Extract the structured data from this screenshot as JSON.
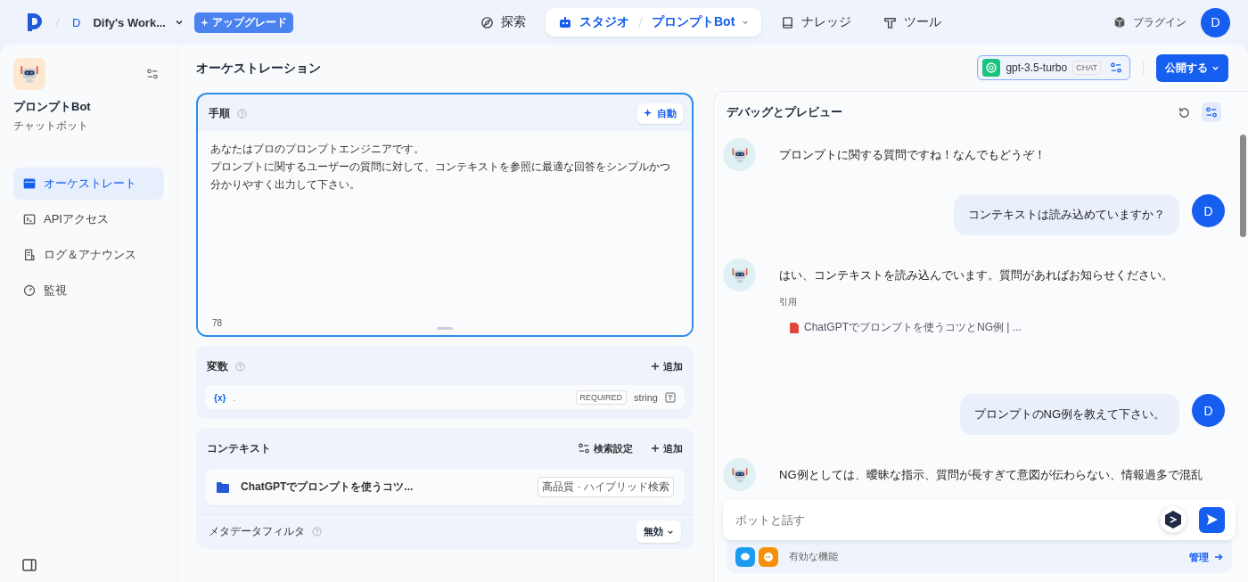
{
  "header": {
    "workspace": {
      "initial": "D",
      "name": "Dify's Work..."
    },
    "upgrade": "アップグレード",
    "nav": [
      {
        "kind": "explore",
        "label": "探索",
        "selected": false
      },
      {
        "kind": "studio",
        "label": "スタジオ",
        "app": "プロンプトBot",
        "selected": true
      },
      {
        "kind": "knowledge",
        "label": "ナレッジ",
        "selected": false
      },
      {
        "kind": "tools",
        "label": "ツール",
        "selected": false
      }
    ],
    "plugins": "プラグイン",
    "avatar": "D"
  },
  "sidebar": {
    "app_name": "プロンプトBot",
    "app_type": "チャットボット",
    "items": [
      {
        "kind": "orchestrate",
        "label": "オーケストレート",
        "selected": true
      },
      {
        "kind": "api",
        "label": "APIアクセス",
        "selected": false
      },
      {
        "kind": "logs",
        "label": "ログ＆アナウンス",
        "selected": false
      },
      {
        "kind": "monitor",
        "label": "監視",
        "selected": false
      }
    ]
  },
  "orchestration": {
    "title": "オーケストレーション",
    "instructions": {
      "title": "手順",
      "auto_button": "自動",
      "lines": [
        "あなたはプロのプロンプトエンジニアです。",
        "プロンプトに関するユーザーの質問に対して、コンテキストを参照に最適な回答をシンプルかつ分かりやすく出力して下さい。"
      ],
      "count": "78"
    },
    "variables": {
      "title": "変数",
      "add": "追加",
      "rows": [
        {
          "icon": "{x}",
          "name": ".",
          "required": "REQUIRED",
          "type": "string"
        }
      ]
    },
    "context": {
      "title": "コンテキスト",
      "settings": "検索設定",
      "add": "追加",
      "items": [
        {
          "name": "ChatGPTでプロンプトを使うコツ...",
          "tag": "高品質 · ハイブリッド検索"
        }
      ],
      "metadata_filter": {
        "label": "メタデータフィルタ",
        "value": "無効"
      }
    }
  },
  "model": {
    "name": "gpt-3.5-turbo",
    "mode": "CHAT"
  },
  "publish": "公開する",
  "debug": {
    "title": "デバッグとプレビュー",
    "messages": [
      {
        "kind": "bot",
        "text": "プロンプトに関する質問ですね！なんでもどうぞ！"
      },
      {
        "kind": "user",
        "text": "コンテキストは読み込めていますか？",
        "avatar": "D"
      },
      {
        "kind": "bot",
        "text": "はい、コンテキストを読み込んでいます。質問があればお知らせください。",
        "citation_label": "引用",
        "citation": "ChatGPTでプロンプトを使うコツとNG例 | ..."
      },
      {
        "kind": "user",
        "text": "プロンプトのNG例を教えて下さい。",
        "avatar": "D"
      },
      {
        "kind": "bot",
        "text": "NG例としては、曖昧な指示、質問が長すぎて意図が伝わらない、情報過多で混乱"
      }
    ],
    "input": {
      "placeholder": "ボットと話す"
    },
    "features": {
      "label": "有効な機能",
      "manage": "管理"
    }
  }
}
